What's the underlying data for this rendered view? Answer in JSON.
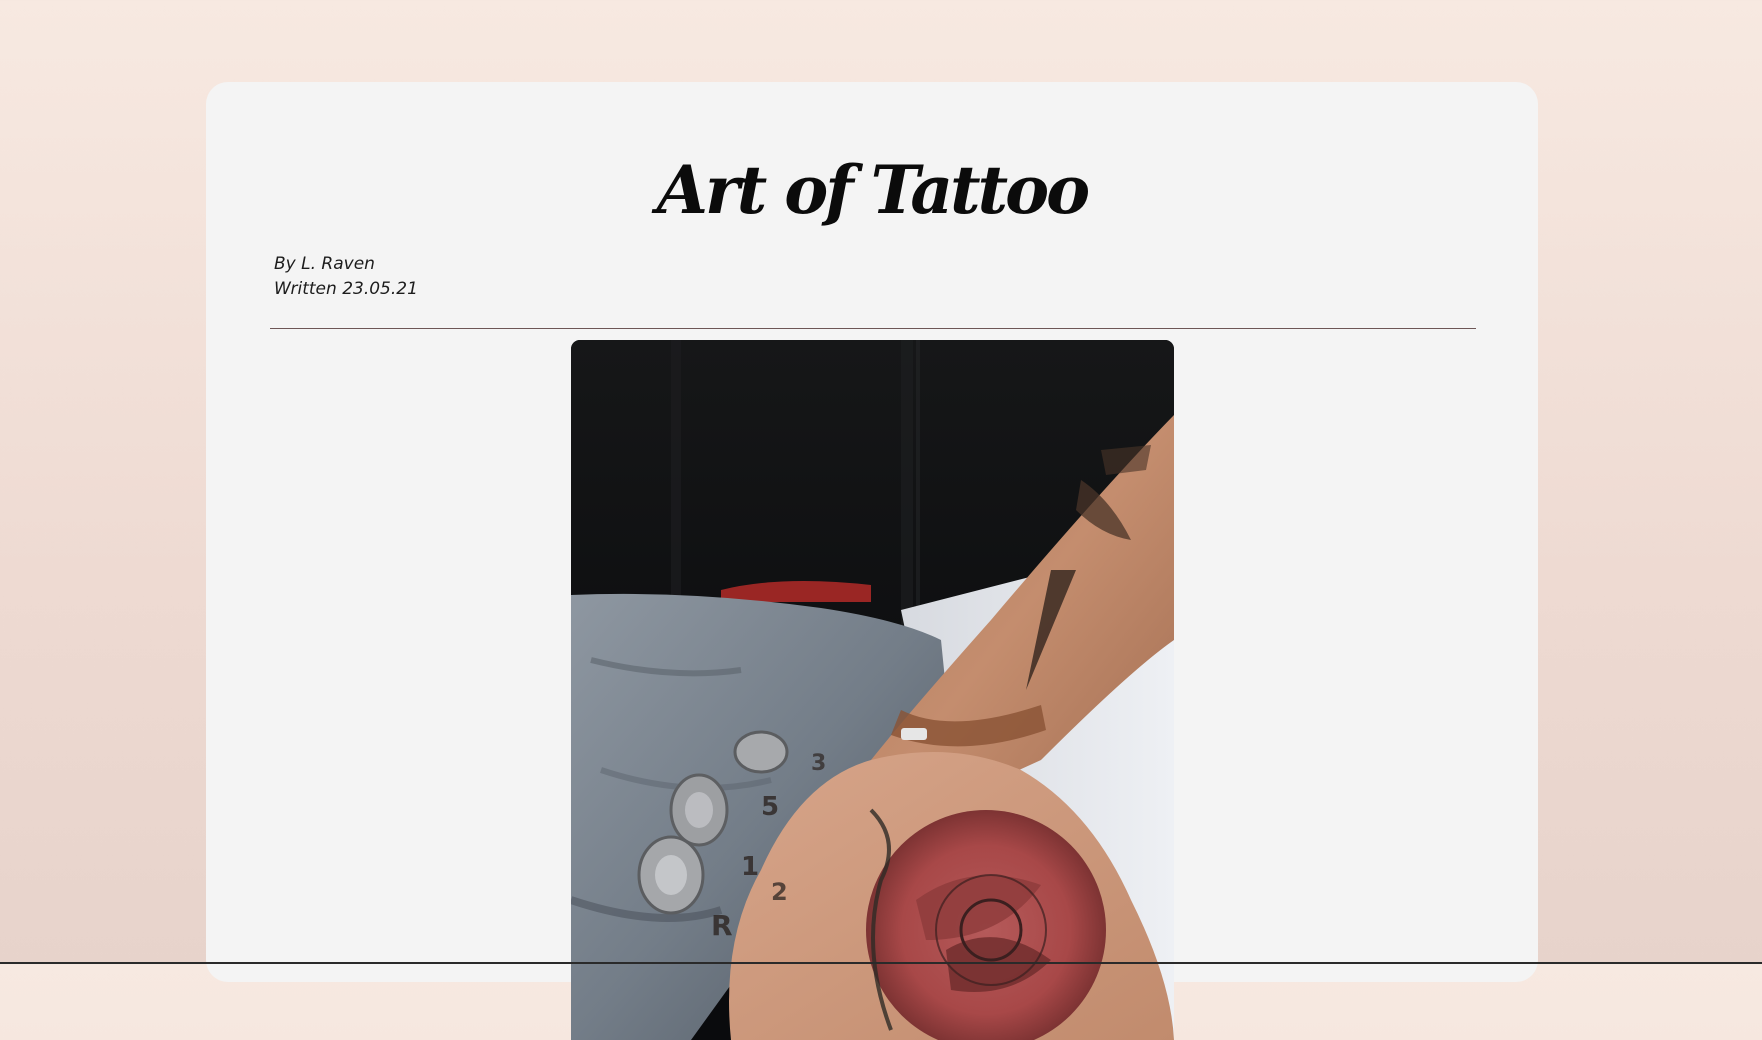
{
  "article": {
    "title": "Art of Tattoo",
    "author": "By L. Raven",
    "written": "Written 23.05.21"
  },
  "hero_image": {
    "subject": "tattooed-hand-with-rings"
  },
  "colors": {
    "background_top": "#f7e9e1",
    "background_bottom": "#e7d3cb",
    "card": "#f4f4f4",
    "title": "#0b0b0b",
    "divider": "#6d5656"
  }
}
